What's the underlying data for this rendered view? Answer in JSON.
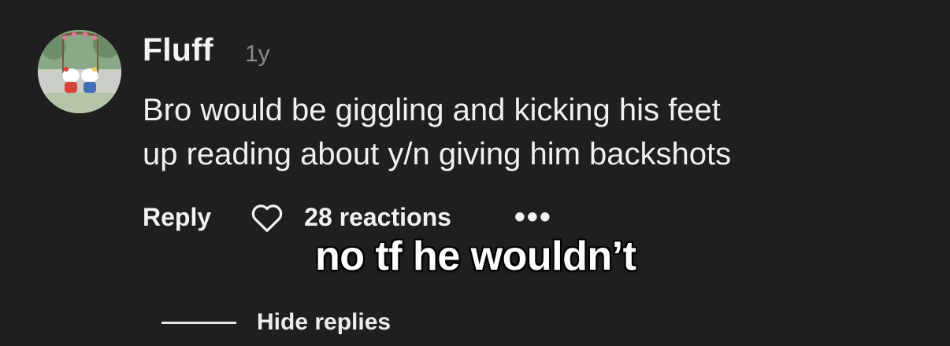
{
  "comment": {
    "username": "Fluff",
    "time_ago": "1y",
    "text_line1": "Bro would be giggling and kicking his feet",
    "text_line2": "up reading about y/n giving him backshots",
    "reactions": "28 reactions"
  },
  "actions": {
    "reply_label": "Reply",
    "more_label": "•••",
    "hide_replies_label": "Hide replies"
  },
  "overlay": {
    "caption": "no tf he wouldn’t"
  },
  "icons": {
    "like": "heart-outline-icon",
    "more": "more-horizontal-icon"
  },
  "colors": {
    "background": "#1f1f1f",
    "text": "#f2f2f2",
    "muted": "#8c8c8c"
  }
}
